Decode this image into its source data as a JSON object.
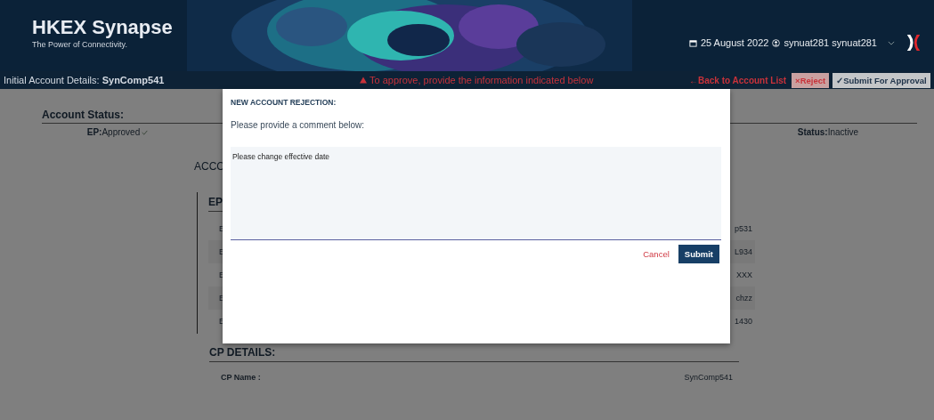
{
  "header": {
    "title": "HKEX Synapse",
    "tagline": "The Power of Connectivity.",
    "date": "25 August 2022",
    "user": "synuat281 synuat281"
  },
  "subheader": {
    "title": "Initial Account Details: **SynComp541**",
    "warning": "To approve, provide the information indicated below",
    "back_link": "←Back to Account List",
    "buttons": [
      {
        "label": "×Reject",
        "kind": "reject"
      },
      {
        "label": "✓Submit For Approval",
        "kind": "approve"
      }
    ]
  },
  "account_status": {
    "heading": "Account Status:",
    "ep_label": "EP:",
    "ep_value": "Approved",
    "status_label": "Status:",
    "status_value": "Inactive"
  },
  "section_heading": "ACCO",
  "ep_details": {
    "heading": "EP",
    "rows": [
      {
        "label": "E",
        "value": "p531"
      },
      {
        "label": "E",
        "value": "L934"
      },
      {
        "label": "E",
        "value": "XXX"
      },
      {
        "label": "E",
        "value": "chzz"
      },
      {
        "label": "E",
        "value": "1430"
      }
    ]
  },
  "cp_details": {
    "heading": "CP DETAILS:",
    "rows": [
      {
        "label": "CP Name :",
        "value": "SynComp541"
      }
    ]
  },
  "dialog": {
    "title": "NEW ACCOUNT REJECTION:",
    "prompt": "Please provide a comment below:",
    "comment": "Please change effective date",
    "cancel": "Cancel",
    "submit": "Submit"
  }
}
